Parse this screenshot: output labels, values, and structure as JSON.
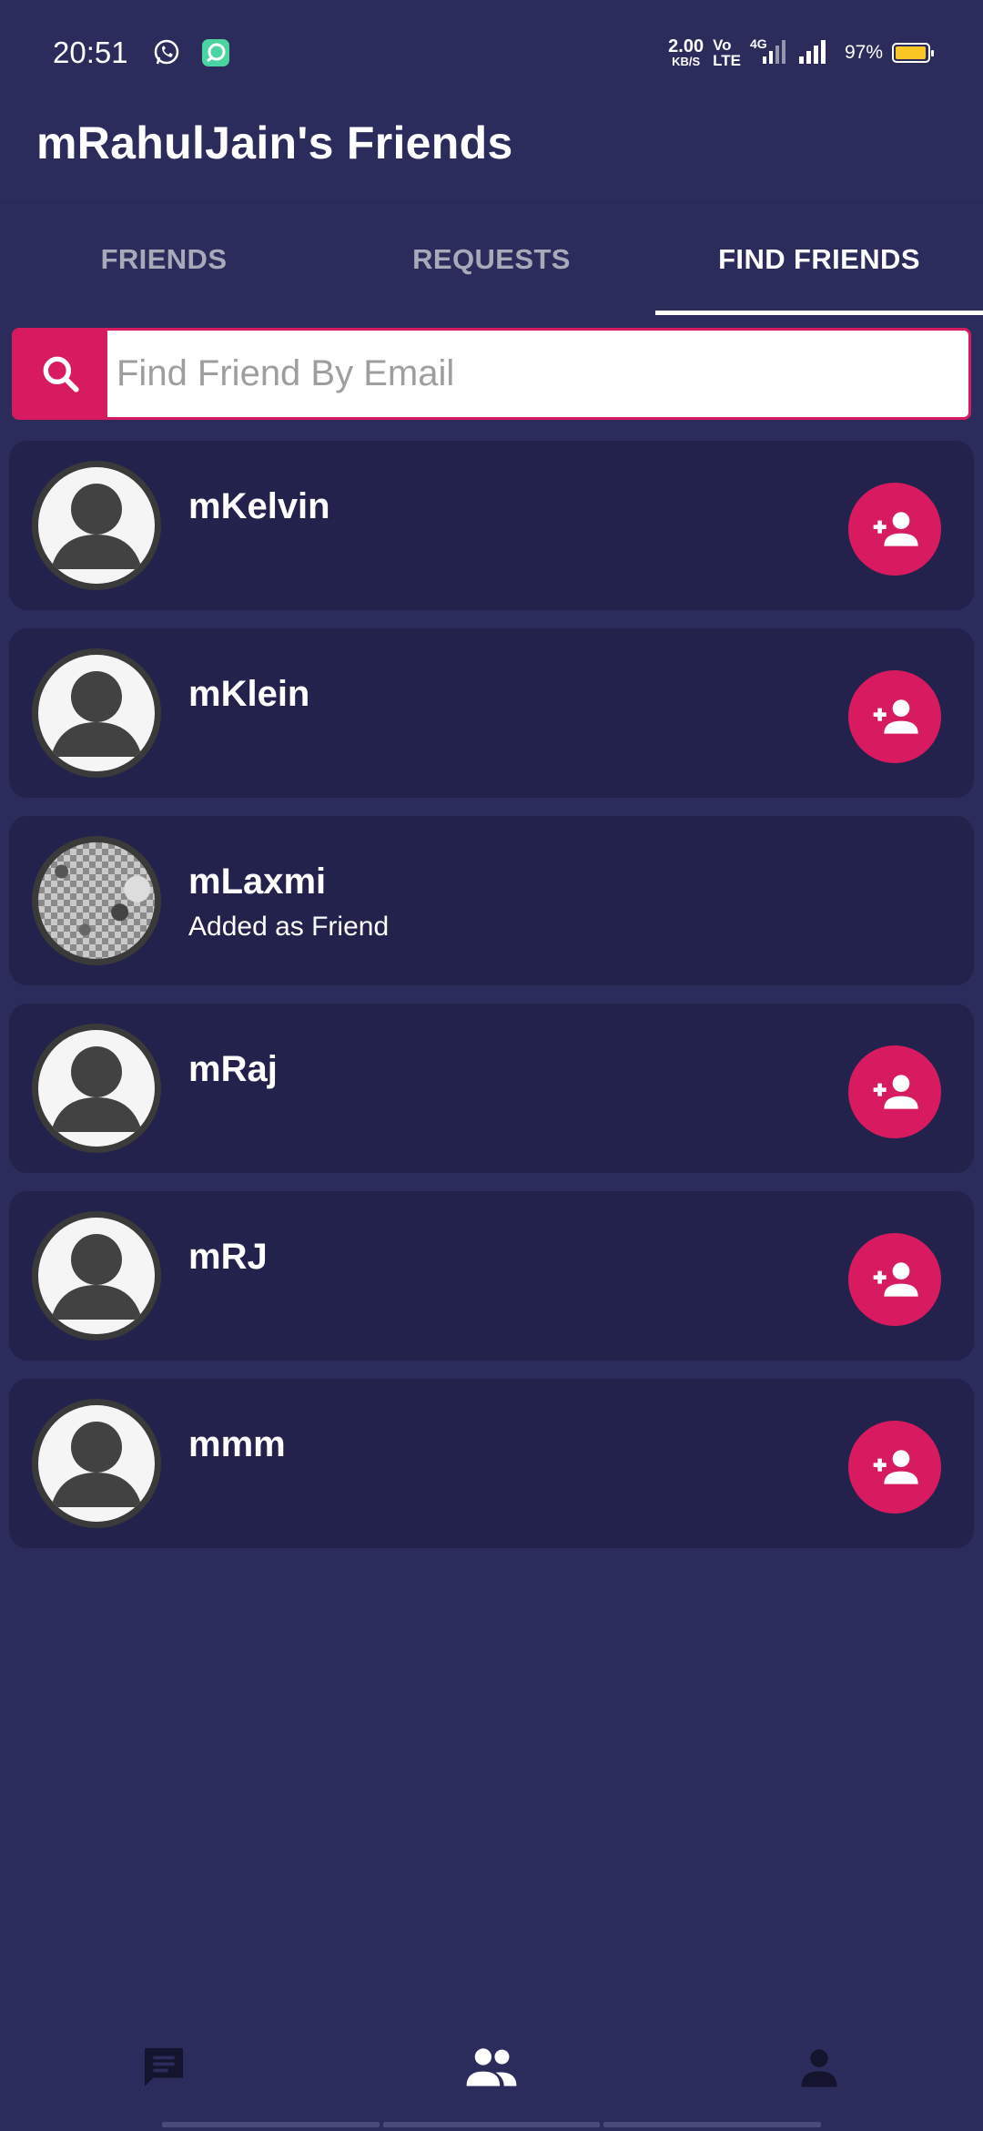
{
  "status_bar": {
    "time": "20:51",
    "net_speed_value": "2.00",
    "net_speed_unit": "KB/S",
    "volte_top": "Vo",
    "volte_bottom": "LTE",
    "network_type": "4G",
    "battery_percent": "97%",
    "battery_level": 0.97,
    "icons": [
      "whatsapp-icon",
      "app-notification-icon",
      "signal-icon",
      "signal-icon",
      "battery-icon"
    ]
  },
  "header": {
    "title": "mRahulJain's Friends"
  },
  "tabs": [
    {
      "label": "FRIENDS",
      "active": false
    },
    {
      "label": "REQUESTS",
      "active": false
    },
    {
      "label": "FIND FRIENDS",
      "active": true
    }
  ],
  "search": {
    "placeholder": "Find Friend By Email",
    "value": "",
    "icon": "search-icon"
  },
  "friends": [
    {
      "name": "mKelvin",
      "status": "",
      "avatar": "default",
      "action": "add-friend"
    },
    {
      "name": "mKlein",
      "status": "",
      "avatar": "default",
      "action": "add-friend"
    },
    {
      "name": "mLaxmi",
      "status": "Added as Friend",
      "avatar": "photo",
      "action": "none"
    },
    {
      "name": "mRaj",
      "status": "",
      "avatar": "default",
      "action": "add-friend"
    },
    {
      "name": "mRJ",
      "status": "",
      "avatar": "default",
      "action": "add-friend"
    },
    {
      "name": "mmm",
      "status": "",
      "avatar": "default",
      "action": "add-friend"
    }
  ],
  "bottom_nav": [
    {
      "icon": "chat-icon"
    },
    {
      "icon": "people-icon"
    },
    {
      "icon": "person-icon"
    }
  ],
  "colors": {
    "background": "#2b2c5b",
    "card": "#22224d",
    "accent": "#d81b60",
    "battery": "#f9c623"
  }
}
